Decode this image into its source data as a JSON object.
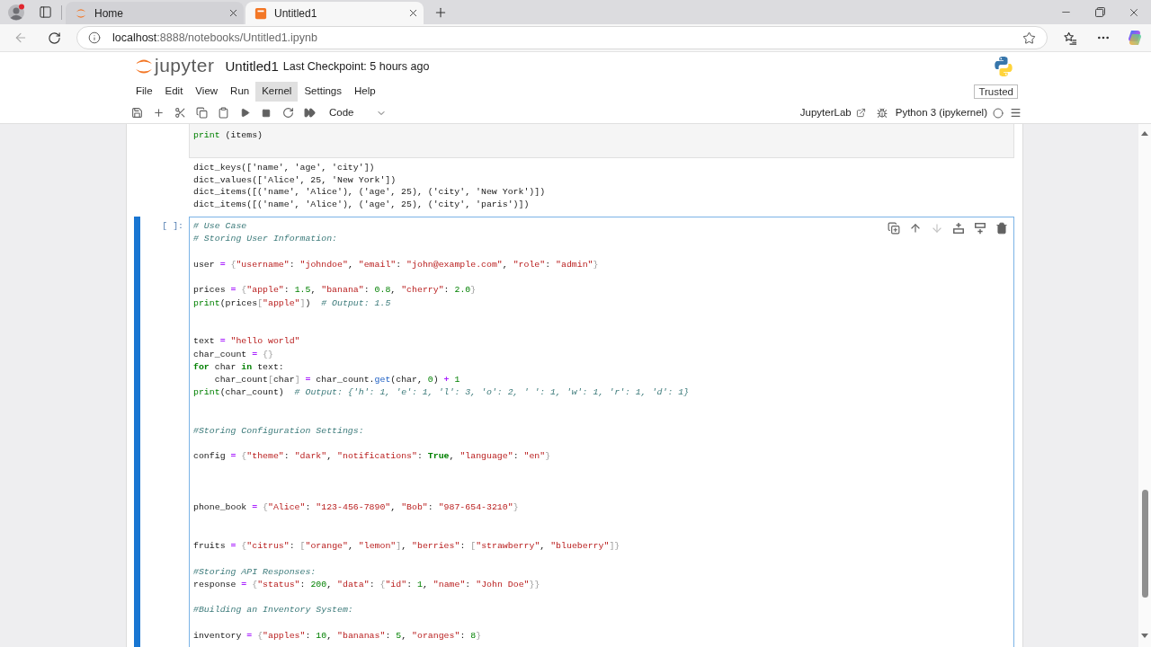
{
  "browser": {
    "tabs": [
      {
        "kind": "home",
        "title": "Home",
        "selected": false
      },
      {
        "kind": "notebook",
        "title": "Untitled1",
        "selected": true
      }
    ],
    "address": {
      "host": "localhost",
      "path": ":8888/notebooks/Untitled1.ipynb"
    }
  },
  "header": {
    "logo_text": "jupyter",
    "notebook_title": "Untitled1",
    "checkpoint": "Last Checkpoint: 5 hours ago"
  },
  "menu": [
    {
      "label": "File",
      "selected": false
    },
    {
      "label": "Edit",
      "selected": false
    },
    {
      "label": "View",
      "selected": false
    },
    {
      "label": "Run",
      "selected": false
    },
    {
      "label": "Kernel",
      "selected": true
    },
    {
      "label": "Settings",
      "selected": false
    },
    {
      "label": "Help",
      "selected": false
    }
  ],
  "trusted": "Trusted",
  "toolbar": {
    "cell_type": "Code",
    "open_in": "JupyterLab",
    "kernel": "Python 3 (ipykernel)"
  },
  "cells": [
    {
      "active": false,
      "input": [
        {
          "kind": "code",
          "tokens": [
            {
              "text": "print",
              "kind": "builtin"
            },
            {
              "text": " (items)",
              "kind": "name"
            }
          ]
        }
      ],
      "output": [
        "dict_keys(['name', 'age', 'city'])",
        "dict_values(['Alice', 25, 'New York'])",
        "dict_items([('name', 'Alice'), ('age', 25), ('city', 'New York')])",
        "dict_items([('name', 'Alice'), ('age', 25), ('city', 'paris')])"
      ]
    },
    {
      "active": true,
      "prompt": "[ ]:",
      "toolbar": [
        {
          "kind": "duplicate",
          "disabled": false
        },
        {
          "kind": "move_up",
          "disabled": false
        },
        {
          "kind": "move_down",
          "disabled": true
        },
        {
          "kind": "insert_above",
          "disabled": false
        },
        {
          "kind": "insert_below",
          "disabled": false
        },
        {
          "kind": "delete",
          "disabled": false
        }
      ],
      "input": [
        {
          "kind": "code",
          "tokens": [
            {
              "text": "# Use Case",
              "kind": "comment"
            }
          ]
        },
        {
          "kind": "code",
          "tokens": [
            {
              "text": "# Storing User Information:",
              "kind": "comment"
            }
          ]
        },
        {
          "kind": "blank"
        },
        {
          "kind": "code",
          "tokens": [
            {
              "text": "user ",
              "kind": "name"
            },
            {
              "text": "=",
              "kind": "operator"
            },
            {
              "text": " {",
              "kind": "bracket"
            },
            {
              "text": "\"username\"",
              "kind": "string"
            },
            {
              "text": ": ",
              "kind": "name"
            },
            {
              "text": "\"johndoe\"",
              "kind": "string"
            },
            {
              "text": ", ",
              "kind": "name"
            },
            {
              "text": "\"email\"",
              "kind": "string"
            },
            {
              "text": ": ",
              "kind": "name"
            },
            {
              "text": "\"john@example.com\"",
              "kind": "string"
            },
            {
              "text": ", ",
              "kind": "name"
            },
            {
              "text": "\"role\"",
              "kind": "string"
            },
            {
              "text": ": ",
              "kind": "name"
            },
            {
              "text": "\"admin\"",
              "kind": "string"
            },
            {
              "text": "}",
              "kind": "bracket"
            }
          ]
        },
        {
          "kind": "blank"
        },
        {
          "kind": "code",
          "tokens": [
            {
              "text": "prices ",
              "kind": "name"
            },
            {
              "text": "=",
              "kind": "operator"
            },
            {
              "text": " {",
              "kind": "bracket"
            },
            {
              "text": "\"apple\"",
              "kind": "string"
            },
            {
              "text": ": ",
              "kind": "name"
            },
            {
              "text": "1.5",
              "kind": "number"
            },
            {
              "text": ", ",
              "kind": "name"
            },
            {
              "text": "\"banana\"",
              "kind": "string"
            },
            {
              "text": ": ",
              "kind": "name"
            },
            {
              "text": "0.8",
              "kind": "number"
            },
            {
              "text": ", ",
              "kind": "name"
            },
            {
              "text": "\"cherry\"",
              "kind": "string"
            },
            {
              "text": ": ",
              "kind": "name"
            },
            {
              "text": "2.0",
              "kind": "number"
            },
            {
              "text": "}",
              "kind": "bracket"
            }
          ]
        },
        {
          "kind": "code",
          "tokens": [
            {
              "text": "print",
              "kind": "builtin"
            },
            {
              "text": "(prices",
              "kind": "name"
            },
            {
              "text": "[",
              "kind": "bracket"
            },
            {
              "text": "\"apple\"",
              "kind": "string"
            },
            {
              "text": "]",
              "kind": "bracket"
            },
            {
              "text": ")  ",
              "kind": "name"
            },
            {
              "text": "# Output: 1.5",
              "kind": "comment"
            }
          ]
        },
        {
          "kind": "blank"
        },
        {
          "kind": "blank"
        },
        {
          "kind": "code",
          "tokens": [
            {
              "text": "text ",
              "kind": "name"
            },
            {
              "text": "=",
              "kind": "operator"
            },
            {
              "text": " \"hello world\"",
              "kind": "string"
            }
          ]
        },
        {
          "kind": "code",
          "tokens": [
            {
              "text": "char_count ",
              "kind": "name"
            },
            {
              "text": "=",
              "kind": "operator"
            },
            {
              "text": " {}",
              "kind": "bracket"
            }
          ]
        },
        {
          "kind": "code",
          "tokens": [
            {
              "text": "for",
              "kind": "keyword"
            },
            {
              "text": " char ",
              "kind": "name"
            },
            {
              "text": "in",
              "kind": "keyword"
            },
            {
              "text": " text:",
              "kind": "name"
            }
          ]
        },
        {
          "kind": "code",
          "tokens": [
            {
              "text": "    char_count",
              "kind": "name"
            },
            {
              "text": "[",
              "kind": "bracket"
            },
            {
              "text": "char",
              "kind": "name"
            },
            {
              "text": "] ",
              "kind": "bracket"
            },
            {
              "text": "=",
              "kind": "operator"
            },
            {
              "text": " char_count.",
              "kind": "name"
            },
            {
              "text": "get",
              "kind": "method"
            },
            {
              "text": "(char, ",
              "kind": "name"
            },
            {
              "text": "0",
              "kind": "number"
            },
            {
              "text": ") ",
              "kind": "name"
            },
            {
              "text": "+",
              "kind": "operator"
            },
            {
              "text": " 1",
              "kind": "number"
            }
          ]
        },
        {
          "kind": "code",
          "tokens": [
            {
              "text": "print",
              "kind": "builtin"
            },
            {
              "text": "(char_count)  ",
              "kind": "name"
            },
            {
              "text": "# Output: {'h': 1, 'e': 1, 'l': 3, 'o': 2, ' ': 1, 'w': 1, 'r': 1, 'd': 1}",
              "kind": "comment"
            }
          ]
        },
        {
          "kind": "blank"
        },
        {
          "kind": "blank"
        },
        {
          "kind": "code",
          "tokens": [
            {
              "text": "#Storing Configuration Settings:",
              "kind": "comment"
            }
          ]
        },
        {
          "kind": "blank"
        },
        {
          "kind": "code",
          "tokens": [
            {
              "text": "config ",
              "kind": "name"
            },
            {
              "text": "=",
              "kind": "operator"
            },
            {
              "text": " {",
              "kind": "bracket"
            },
            {
              "text": "\"theme\"",
              "kind": "string"
            },
            {
              "text": ": ",
              "kind": "name"
            },
            {
              "text": "\"dark\"",
              "kind": "string"
            },
            {
              "text": ", ",
              "kind": "name"
            },
            {
              "text": "\"notifications\"",
              "kind": "string"
            },
            {
              "text": ": ",
              "kind": "name"
            },
            {
              "text": "True",
              "kind": "keyword"
            },
            {
              "text": ", ",
              "kind": "name"
            },
            {
              "text": "\"language\"",
              "kind": "string"
            },
            {
              "text": ": ",
              "kind": "name"
            },
            {
              "text": "\"en\"",
              "kind": "string"
            },
            {
              "text": "}",
              "kind": "bracket"
            }
          ]
        },
        {
          "kind": "blank"
        },
        {
          "kind": "blank"
        },
        {
          "kind": "blank"
        },
        {
          "kind": "code",
          "tokens": [
            {
              "text": "phone_book ",
              "kind": "name"
            },
            {
              "text": "=",
              "kind": "operator"
            },
            {
              "text": " {",
              "kind": "bracket"
            },
            {
              "text": "\"Alice\"",
              "kind": "string"
            },
            {
              "text": ": ",
              "kind": "name"
            },
            {
              "text": "\"123-456-7890\"",
              "kind": "string"
            },
            {
              "text": ", ",
              "kind": "name"
            },
            {
              "text": "\"Bob\"",
              "kind": "string"
            },
            {
              "text": ": ",
              "kind": "name"
            },
            {
              "text": "\"987-654-3210\"",
              "kind": "string"
            },
            {
              "text": "}",
              "kind": "bracket"
            }
          ]
        },
        {
          "kind": "blank"
        },
        {
          "kind": "blank"
        },
        {
          "kind": "code",
          "tokens": [
            {
              "text": "fruits ",
              "kind": "name"
            },
            {
              "text": "=",
              "kind": "operator"
            },
            {
              "text": " {",
              "kind": "bracket"
            },
            {
              "text": "\"citrus\"",
              "kind": "string"
            },
            {
              "text": ": ",
              "kind": "name"
            },
            {
              "text": "[",
              "kind": "bracket"
            },
            {
              "text": "\"orange\"",
              "kind": "string"
            },
            {
              "text": ", ",
              "kind": "name"
            },
            {
              "text": "\"lemon\"",
              "kind": "string"
            },
            {
              "text": "]",
              "kind": "bracket"
            },
            {
              "text": ", ",
              "kind": "name"
            },
            {
              "text": "\"berries\"",
              "kind": "string"
            },
            {
              "text": ": ",
              "kind": "name"
            },
            {
              "text": "[",
              "kind": "bracket"
            },
            {
              "text": "\"strawberry\"",
              "kind": "string"
            },
            {
              "text": ", ",
              "kind": "name"
            },
            {
              "text": "\"blueberry\"",
              "kind": "string"
            },
            {
              "text": "]}",
              "kind": "bracket"
            }
          ]
        },
        {
          "kind": "blank"
        },
        {
          "kind": "code",
          "tokens": [
            {
              "text": "#Storing API Responses:",
              "kind": "comment"
            }
          ]
        },
        {
          "kind": "code",
          "tokens": [
            {
              "text": "response ",
              "kind": "name"
            },
            {
              "text": "=",
              "kind": "operator"
            },
            {
              "text": " {",
              "kind": "bracket"
            },
            {
              "text": "\"status\"",
              "kind": "string"
            },
            {
              "text": ": ",
              "kind": "name"
            },
            {
              "text": "200",
              "kind": "number"
            },
            {
              "text": ", ",
              "kind": "name"
            },
            {
              "text": "\"data\"",
              "kind": "string"
            },
            {
              "text": ": ",
              "kind": "name"
            },
            {
              "text": "{",
              "kind": "bracket"
            },
            {
              "text": "\"id\"",
              "kind": "string"
            },
            {
              "text": ": ",
              "kind": "name"
            },
            {
              "text": "1",
              "kind": "number"
            },
            {
              "text": ", ",
              "kind": "name"
            },
            {
              "text": "\"name\"",
              "kind": "string"
            },
            {
              "text": ": ",
              "kind": "name"
            },
            {
              "text": "\"John Doe\"",
              "kind": "string"
            },
            {
              "text": "}}",
              "kind": "bracket"
            }
          ]
        },
        {
          "kind": "blank"
        },
        {
          "kind": "code",
          "tokens": [
            {
              "text": "#Building an Inventory System:",
              "kind": "comment"
            }
          ]
        },
        {
          "kind": "blank"
        },
        {
          "kind": "code",
          "tokens": [
            {
              "text": "inventory ",
              "kind": "name"
            },
            {
              "text": "=",
              "kind": "operator"
            },
            {
              "text": " {",
              "kind": "bracket"
            },
            {
              "text": "\"apples\"",
              "kind": "string"
            },
            {
              "text": ": ",
              "kind": "name"
            },
            {
              "text": "10",
              "kind": "number"
            },
            {
              "text": ", ",
              "kind": "name"
            },
            {
              "text": "\"bananas\"",
              "kind": "string"
            },
            {
              "text": ": ",
              "kind": "name"
            },
            {
              "text": "5",
              "kind": "number"
            },
            {
              "text": ", ",
              "kind": "name"
            },
            {
              "text": "\"oranges\"",
              "kind": "string"
            },
            {
              "text": ": ",
              "kind": "name"
            },
            {
              "text": "8",
              "kind": "number"
            },
            {
              "text": "}",
              "kind": "bracket"
            }
          ]
        }
      ]
    }
  ]
}
